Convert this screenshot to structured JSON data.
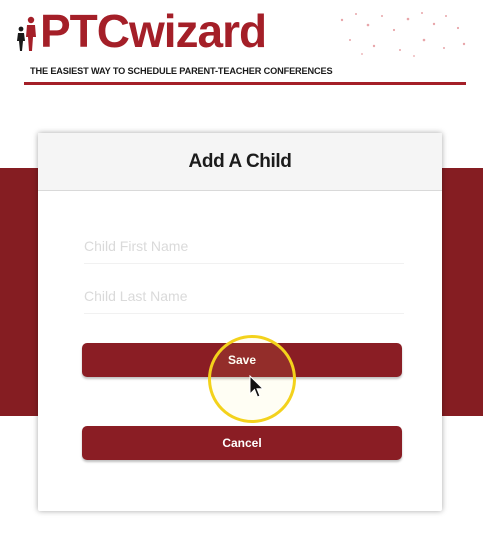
{
  "brand": {
    "logo_text": "PTCwizard",
    "tagline": "THE EASIEST WAY TO SCHEDULE PARENT-TEACHER CONFERENCES",
    "color": "#a41f28"
  },
  "modal": {
    "title": "Add A Child",
    "first_name": {
      "value": "",
      "placeholder": "Child First Name"
    },
    "last_name": {
      "value": "",
      "placeholder": "Child Last Name"
    },
    "save_label": "Save",
    "cancel_label": "Cancel",
    "button_color": "#8a1d24"
  },
  "overlay": {
    "highlight_color": "#f3d21c",
    "cursor_icon": "arrow-cursor-icon"
  }
}
